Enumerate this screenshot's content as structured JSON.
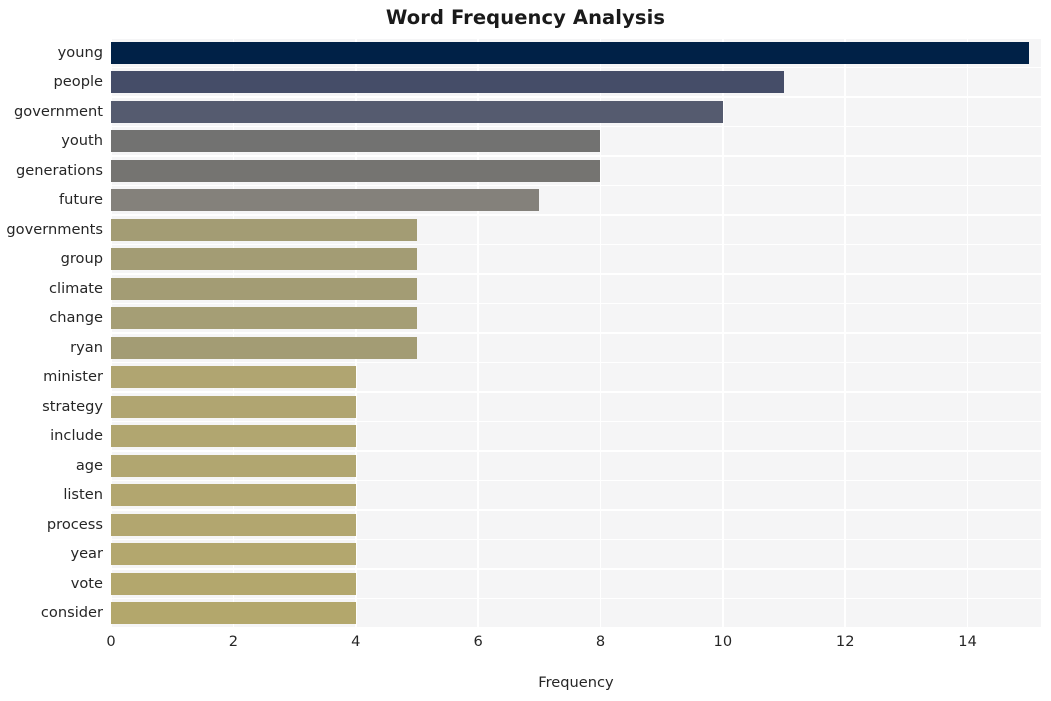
{
  "chart_data": {
    "type": "bar",
    "orientation": "horizontal",
    "title": "Word Frequency Analysis",
    "xlabel": "Frequency",
    "ylabel": "",
    "xlim": [
      0,
      15.2
    ],
    "xticks": [
      0,
      2,
      4,
      6,
      8,
      10,
      12,
      14
    ],
    "xtick_labels": [
      "0",
      "2",
      "4",
      "6",
      "8",
      "10",
      "12",
      "14"
    ],
    "grid": true,
    "legend": null,
    "categories": [
      "young",
      "people",
      "government",
      "youth",
      "generations",
      "future",
      "governments",
      "group",
      "climate",
      "change",
      "ryan",
      "minister",
      "strategy",
      "include",
      "age",
      "listen",
      "process",
      "year",
      "vote",
      "consider"
    ],
    "values": [
      15,
      11,
      10,
      8,
      8,
      7,
      5,
      5,
      5,
      5,
      5,
      4,
      4,
      4,
      4,
      4,
      4,
      4,
      4,
      4
    ],
    "bar_colors": [
      "#002147",
      "#454d68",
      "#555b6f",
      "#727271",
      "#757471",
      "#84817b",
      "#a39c74",
      "#a39c74",
      "#a39c74",
      "#a59e75",
      "#a39c74",
      "#b0a571",
      "#b0a571",
      "#b1a670",
      "#b1a670",
      "#b2a66f",
      "#b2a66f",
      "#b3a76e",
      "#b3a76d",
      "#b3a76c"
    ],
    "plot_background": "#f5f5f6",
    "grid_color": "#ffffff",
    "figure_background": "#ffffff"
  }
}
